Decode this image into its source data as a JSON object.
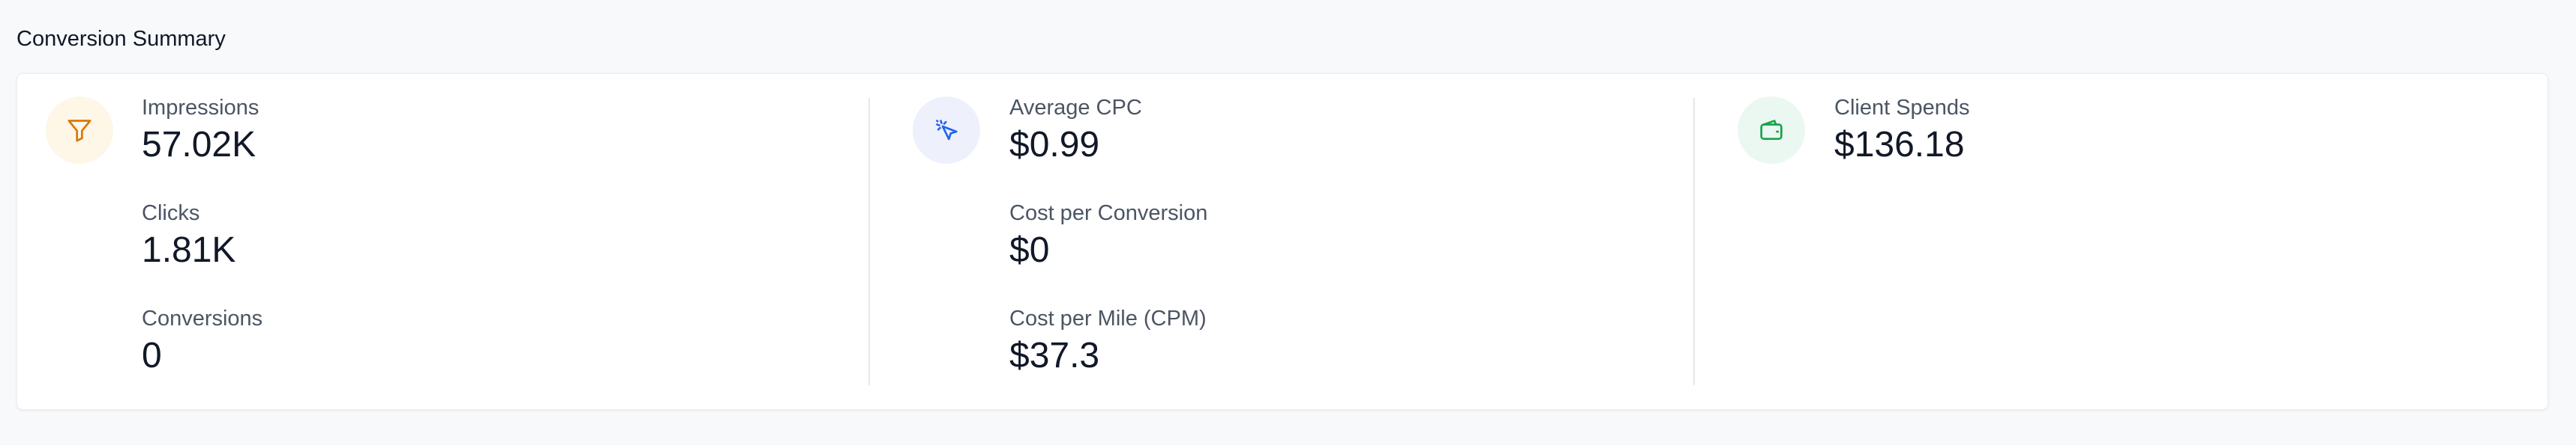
{
  "title": "Conversion Summary",
  "colors": {
    "funnel": "#d97706",
    "funnel_bg": "#fef6e7",
    "cursor": "#2563eb",
    "cursor_bg": "#eef1fb",
    "wallet": "#16a34a",
    "wallet_bg": "#ebf8f1"
  },
  "groups": [
    {
      "icon": "funnel-icon",
      "metrics": [
        {
          "label": "Impressions",
          "value": "57.02K"
        },
        {
          "label": "Clicks",
          "value": "1.81K"
        },
        {
          "label": "Conversions",
          "value": "0"
        }
      ]
    },
    {
      "icon": "cursor-click-icon",
      "metrics": [
        {
          "label": "Average CPC",
          "value": "$0.99"
        },
        {
          "label": "Cost per Conversion",
          "value": "$0"
        },
        {
          "label": "Cost per Mile (CPM)",
          "value": "$37.3"
        }
      ]
    },
    {
      "icon": "wallet-icon",
      "metrics": [
        {
          "label": "Client Spends",
          "value": "$136.18"
        }
      ]
    }
  ]
}
